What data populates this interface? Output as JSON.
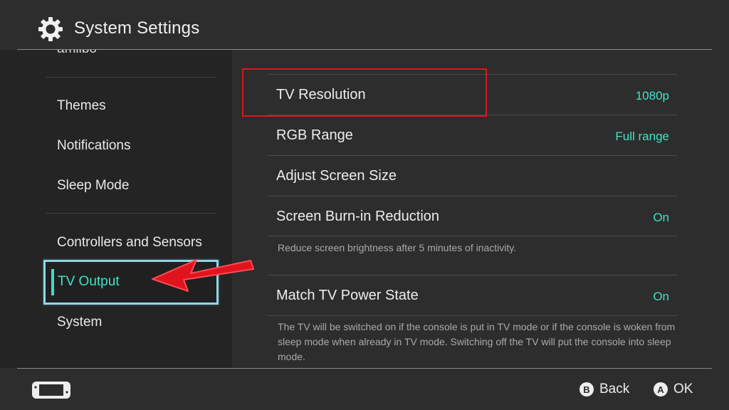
{
  "header": {
    "title": "System Settings",
    "icon": "gear-icon"
  },
  "sidebar": {
    "cut_item": "amiibo",
    "items": [
      {
        "label": "Themes"
      },
      {
        "label": "Notifications"
      },
      {
        "label": "Sleep Mode"
      },
      {
        "label": "Controllers and Sensors"
      },
      {
        "label": "TV Output",
        "selected": true
      },
      {
        "label": "System"
      }
    ]
  },
  "content": {
    "rows": [
      {
        "label": "TV Resolution",
        "value": "1080p"
      },
      {
        "label": "RGB Range",
        "value": "Full range"
      },
      {
        "label": "Adjust Screen Size",
        "value": ""
      },
      {
        "label": "Screen Burn-in Reduction",
        "value": "On",
        "description": "Reduce screen brightness after 5 minutes of inactivity."
      },
      {
        "label": "Match TV Power State",
        "value": "On",
        "description": "The TV will be switched on if the console is put in TV mode or if the console is woken from sleep mode when already in TV mode. Switching off the TV will put the console into sleep mode."
      }
    ]
  },
  "footer": {
    "back": {
      "button": "B",
      "label": "Back"
    },
    "ok": {
      "button": "A",
      "label": "OK"
    }
  },
  "colors": {
    "accent": "#3fe3c7",
    "selection_border": "#8fd6e6",
    "annotation_red": "#e0141e",
    "background": "#2d2d2d",
    "sidebar_bg": "#242424"
  }
}
